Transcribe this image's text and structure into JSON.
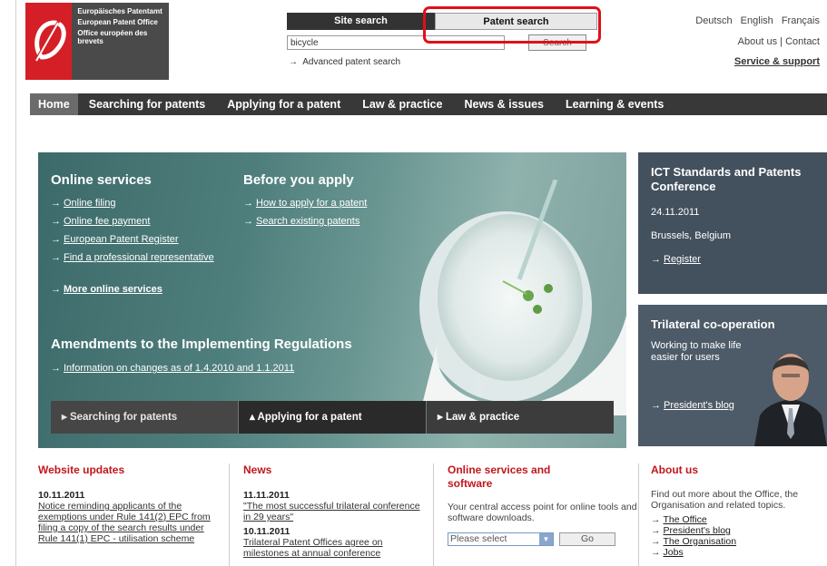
{
  "header": {
    "logo_lines": [
      "Europäisches Patentamt",
      "European Patent Office",
      "Office européen des brevets"
    ],
    "search_tabs": [
      "Site search",
      "Patent search"
    ],
    "search_value": "bicycle",
    "search_button": "Search",
    "advanced_search": "Advanced patent search",
    "languages": [
      "Deutsch",
      "English",
      "Français"
    ],
    "about_us": "About us",
    "contact": "Contact",
    "service_support": "Service & support"
  },
  "nav": {
    "items": [
      "Home",
      "Searching for patents",
      "Applying for a patent",
      "Law & practice",
      "News & issues",
      "Learning & events"
    ]
  },
  "hero": {
    "online_services_title": "Online services",
    "online_links": [
      "Online filing",
      "Online fee payment",
      "European Patent Register",
      "Find a professional representative"
    ],
    "more_online": "More online services",
    "before_title": "Before you apply",
    "before_links": [
      "How to apply for a patent",
      "Search existing patents"
    ],
    "amendments_title": "Amendments to the Implementing Regulations",
    "amendments_link": "Information on changes as of 1.4.2010 and 1.1.2011",
    "bar_items": [
      "Searching for patents",
      "Applying for a patent",
      "Law & practice"
    ]
  },
  "ict": {
    "title": "ICT Standards and Patents Conference",
    "date": "24.11.2011",
    "place": "Brussels, Belgium",
    "register": "Register"
  },
  "trilateral": {
    "title": "Trilateral co-operation",
    "text": "Working to make life easier for users",
    "blog": "President's blog"
  },
  "updates": {
    "title": "Website updates",
    "date": "10.11.2011",
    "text": "Notice reminding applicants of the exemptions under Rule 141(2) EPC from filing a copy of the search results under Rule 141(1) EPC - utilisation scheme"
  },
  "news": {
    "title": "News",
    "items": [
      {
        "date": "11.11.2011",
        "text": "\"The most successful trilateral conference in 29 years\""
      },
      {
        "date": "10.11.2011",
        "text": "Trilateral Patent Offices agree on milestones at annual conference"
      }
    ]
  },
  "online": {
    "title": "Online services and software",
    "text": "Your central access point for online tools and software downloads.",
    "select_value": "Please select",
    "go": "Go"
  },
  "about": {
    "title": "About us",
    "text": "Find out more about the Office, the Organisation and related topics.",
    "links": [
      "The Office",
      "President's blog",
      "The Organisation",
      "Jobs"
    ]
  },
  "colors": {
    "nav_bg": "#383838",
    "heading_red": "#c2161c",
    "logo_red": "#d41f26",
    "highlight": "#e0101a"
  }
}
